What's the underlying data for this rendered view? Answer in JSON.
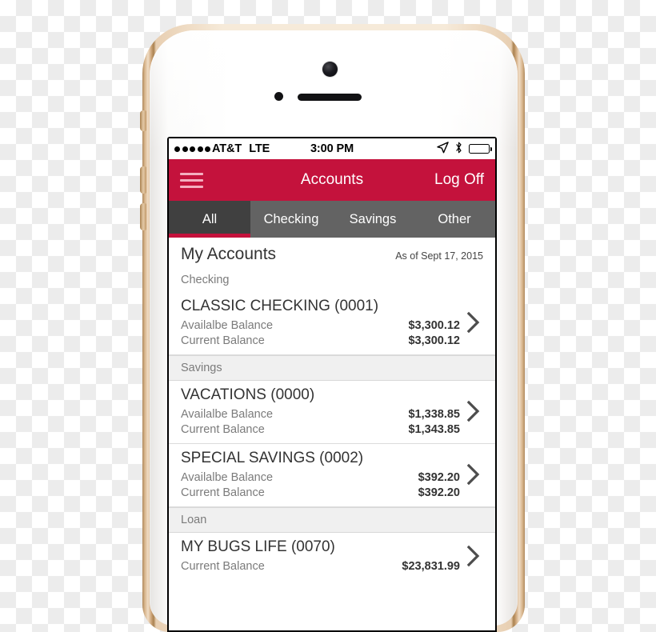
{
  "device": {
    "name": "iphone-gold",
    "body_color": "#ffffff",
    "rail_color": "#d8b58c",
    "hardware": {
      "camera": "front-camera",
      "sensor": "ambient-light-sensor",
      "speaker": "earpiece-speaker",
      "silent_switch": "silent-switch",
      "volume_up": "volume-up-button",
      "volume_down": "volume-down-button"
    }
  },
  "status_bar": {
    "signal_dots": 5,
    "carrier": "AT&T",
    "network": "LTE",
    "time": "3:00 PM",
    "icons": [
      "location-arrow-icon",
      "bluetooth-icon",
      "battery-icon"
    ]
  },
  "nav_bar": {
    "menu_icon": "hamburger-menu-icon",
    "title": "Accounts",
    "right_action": "Log Off",
    "background": "#C4123C"
  },
  "tabs": {
    "active_index": 0,
    "items": [
      {
        "label": "All"
      },
      {
        "label": "Checking"
      },
      {
        "label": "Savings"
      },
      {
        "label": "Other"
      }
    ],
    "active_bg": "#404040",
    "inactive_bg": "#636363",
    "indicator_color": "#C4123C"
  },
  "content": {
    "heading": "My Accounts",
    "as_of": "As of Sept 17, 2015",
    "sections": [
      {
        "title": "Checking",
        "shaded": false,
        "accounts": [
          {
            "name": "CLASSIC CHECKING (0001)",
            "balances": [
              {
                "label": "Availalbe Balance",
                "amount": "$3,300.12"
              },
              {
                "label": "Current Balance",
                "amount": "$3,300.12"
              }
            ]
          }
        ]
      },
      {
        "title": "Savings",
        "shaded": true,
        "accounts": [
          {
            "name": "VACATIONS (0000)",
            "balances": [
              {
                "label": "Availalbe Balance",
                "amount": "$1,338.85"
              },
              {
                "label": "Current Balance",
                "amount": "$1,343.85"
              }
            ]
          },
          {
            "name": "SPECIAL SAVINGS (0002)",
            "balances": [
              {
                "label": "Availalbe Balance",
                "amount": "$392.20"
              },
              {
                "label": "Current Balance",
                "amount": "$392.20"
              }
            ]
          }
        ]
      },
      {
        "title": "Loan",
        "shaded": true,
        "accounts": [
          {
            "name": "MY BUGS LIFE (0070)",
            "balances": [
              {
                "label": "Current Balance",
                "amount": "$23,831.99"
              }
            ]
          }
        ]
      }
    ],
    "chevron_icon": "chevron-right-icon"
  }
}
